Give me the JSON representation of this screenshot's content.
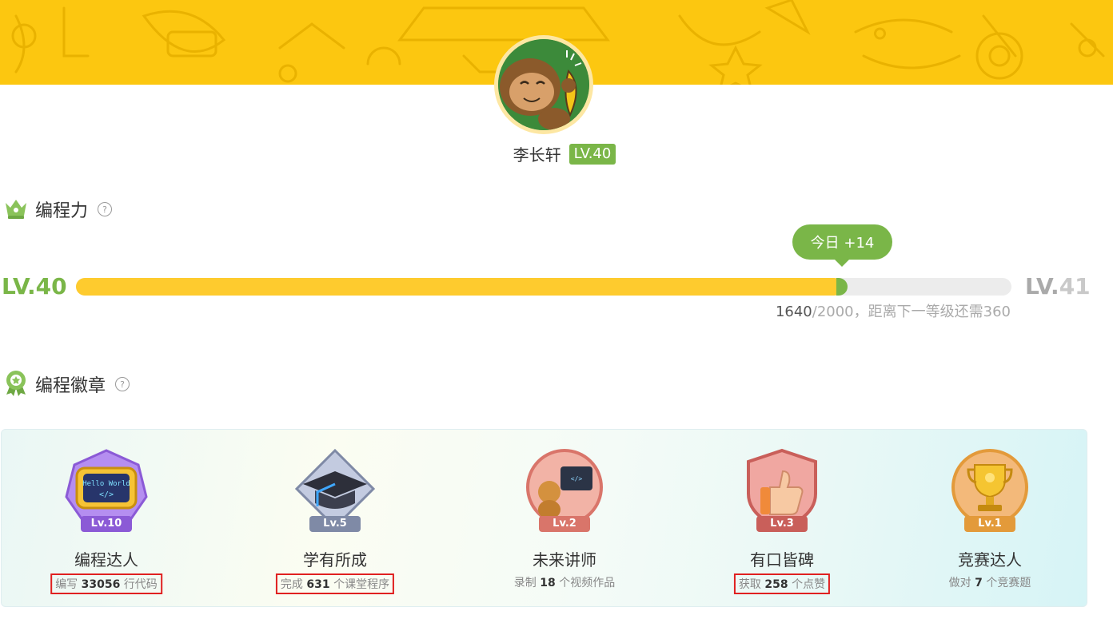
{
  "user": {
    "name": "李长轩",
    "level_tag": "LV.40"
  },
  "coding_power": {
    "title": "编程力",
    "help_icon": "question-circle-icon",
    "title_icon": "crown-icon",
    "level_current": "LV.40",
    "level_next_prefix": "LV.",
    "level_next_num": "41",
    "today_label": "今日 +14",
    "progress": {
      "current": 1640,
      "max": 2000,
      "fraction": 0.82
    },
    "progress_current_text": "1640",
    "progress_rest_text": "/2000，距离下一等级还需360"
  },
  "badges_section": {
    "title": "编程徽章",
    "title_icon": "medal-icon",
    "help_icon": "question-circle-icon",
    "items": [
      {
        "name": "编程达人",
        "level": "Lv.10",
        "pre": "编写",
        "value": "33056",
        "post": "行代码",
        "icon": "hello-world-screen-icon",
        "color": "#8b5ad6"
      },
      {
        "name": "学有所成",
        "level": "Lv.5",
        "pre": "完成",
        "value": "631",
        "post": "个课堂程序",
        "icon": "graduation-cap-icon",
        "color": "#7f8aa6"
      },
      {
        "name": "未来讲师",
        "level": "Lv.2",
        "pre": "录制",
        "value": "18",
        "post": "个视频作品",
        "icon": "monkey-teacher-icon",
        "color": "#d9756a"
      },
      {
        "name": "有口皆碑",
        "level": "Lv.3",
        "pre": "获取",
        "value": "258",
        "post": "个点赞",
        "icon": "thumbs-up-icon",
        "color": "#c95f5a"
      },
      {
        "name": "竞赛达人",
        "level": "Lv.1",
        "pre": "做对",
        "value": "7",
        "post": "个竞赛题",
        "icon": "trophy-icon",
        "color": "#e39a3a"
      }
    ]
  },
  "colors": {
    "banner": "#fcc710",
    "accent_green": "#7ab648",
    "progress_yellow": "#fecb2e"
  }
}
